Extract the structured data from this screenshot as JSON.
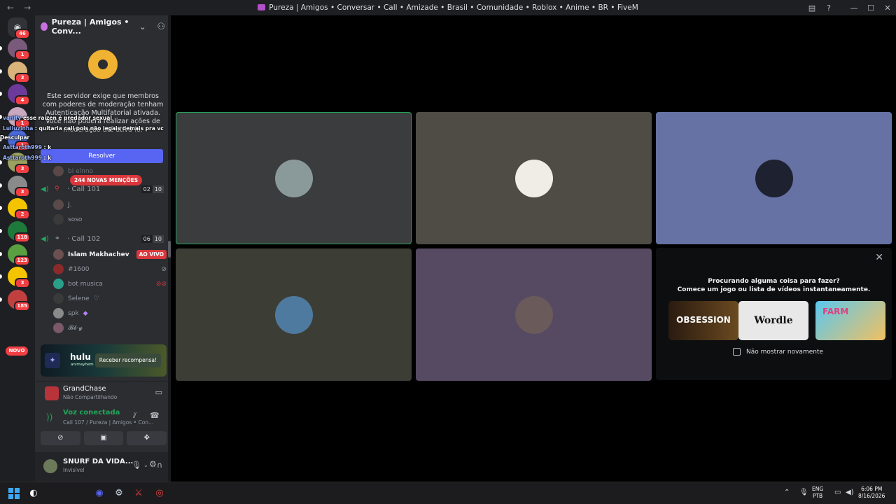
{
  "titlebar": {
    "title": "Pureza | Amigos • Conversar • Call • Amizade • Brasil • Comunidade • Roblox • Anime • BR • FiveM",
    "back": "←",
    "forward": "→",
    "min": "—",
    "max": "☐",
    "close": "✕"
  },
  "rail": {
    "home_badge": "46",
    "servers": [
      {
        "badge": "1",
        "color": "#7a5a7a"
      },
      {
        "badge": "3",
        "color": "#d9b37a"
      },
      {
        "badge": "4",
        "color": "#6b3a9a"
      },
      {
        "badge": "1",
        "color": "#c9a9c0"
      },
      {
        "badge": "1",
        "color": "#4a6ad9"
      },
      {
        "badge": "3",
        "color": "#9aa060"
      },
      {
        "badge": "3",
        "color": "#8a8a8a"
      },
      {
        "badge": "2",
        "color": "#f5c400"
      },
      {
        "badge": "118",
        "color": "#1e7a3a"
      },
      {
        "badge": "123",
        "color": "#5aa040"
      },
      {
        "badge": "3",
        "color": "#f5c400"
      },
      {
        "badge": "185",
        "color": "#c04040"
      }
    ],
    "novo": "NOVO"
  },
  "sidebar": {
    "server_name": "Pureza | Amigos • Conv...",
    "mfa_text": "Este servidor exige que membros com poderes de moderação tenham Autenticação Multifatorial ativada. Você não poderá realizar ações de moderação até ativá-lo.",
    "resolve": "Resolver",
    "partial_member": "bi elnno",
    "mentions": "244 NOVAS MENÇÕES",
    "call101": {
      "name": "Call 101",
      "count": "02",
      "limit": "10",
      "members": [
        "J.",
        "soso"
      ]
    },
    "call102": {
      "name": "Call 102",
      "count": "06",
      "limit": "10",
      "members": [
        {
          "name": "Islam Makhachev",
          "tag": "AO VIVO"
        },
        {
          "name": "#1600"
        },
        {
          "name": "bot musica"
        },
        {
          "name": "Selene"
        },
        {
          "name": "spk"
        },
        {
          "name": "𝓑𝓫·𝔂"
        }
      ]
    },
    "promo": {
      "brand": "hulu",
      "sub": "animayhem",
      "button": "Receber recompensa!"
    },
    "activity": {
      "game": "GrandChase",
      "status": "Não Compartilhando"
    },
    "voice": {
      "title": "Voz conectada",
      "sub": "Call 107 / Pureza | Amigos • Con..."
    },
    "user": {
      "name": "SNURF DA VIDA...",
      "status": "Invisível"
    }
  },
  "overlay": {
    "line1_user": "vanity",
    "line1_text": "esse raizen é predador sexual",
    "line2_user": "Lulluzinha",
    "line2_text": "quitaria call pois não legais demais pra vc",
    "line3": "Desculpar",
    "line4_user": "Asttaroth999",
    "line4_text": "k",
    "line5_user": "Asttaroth999",
    "line5_text": "k"
  },
  "stage": {
    "tiles": [
      {
        "bg": "#3a3c3d",
        "avatar": "#8a9a9a",
        "speaking": true
      },
      {
        "bg": "#4e4c45",
        "avatar": "#f0ece6",
        "speaking": false
      },
      {
        "bg": "#6671a4",
        "avatar": "#1e2130",
        "speaking": false
      },
      {
        "bg": "#3c3e36",
        "avatar": "#4f7aa0",
        "speaking": false
      },
      {
        "bg": "#564a62",
        "avatar": "#6a5a5a",
        "speaking": false
      }
    ],
    "activity_panel": {
      "title1": "Procurando alguma coisa para fazer?",
      "title2": "Comece um jogo ou lista de vídeos instantaneamente.",
      "games": [
        "OBSESSION",
        "Wordle",
        "FARM"
      ],
      "checkbox": "Não mostrar novamente"
    }
  },
  "taskbar": {
    "lang1": "ENG",
    "lang2": "PTB",
    "time": "6:06 PM",
    "date": "8/16/2026"
  }
}
